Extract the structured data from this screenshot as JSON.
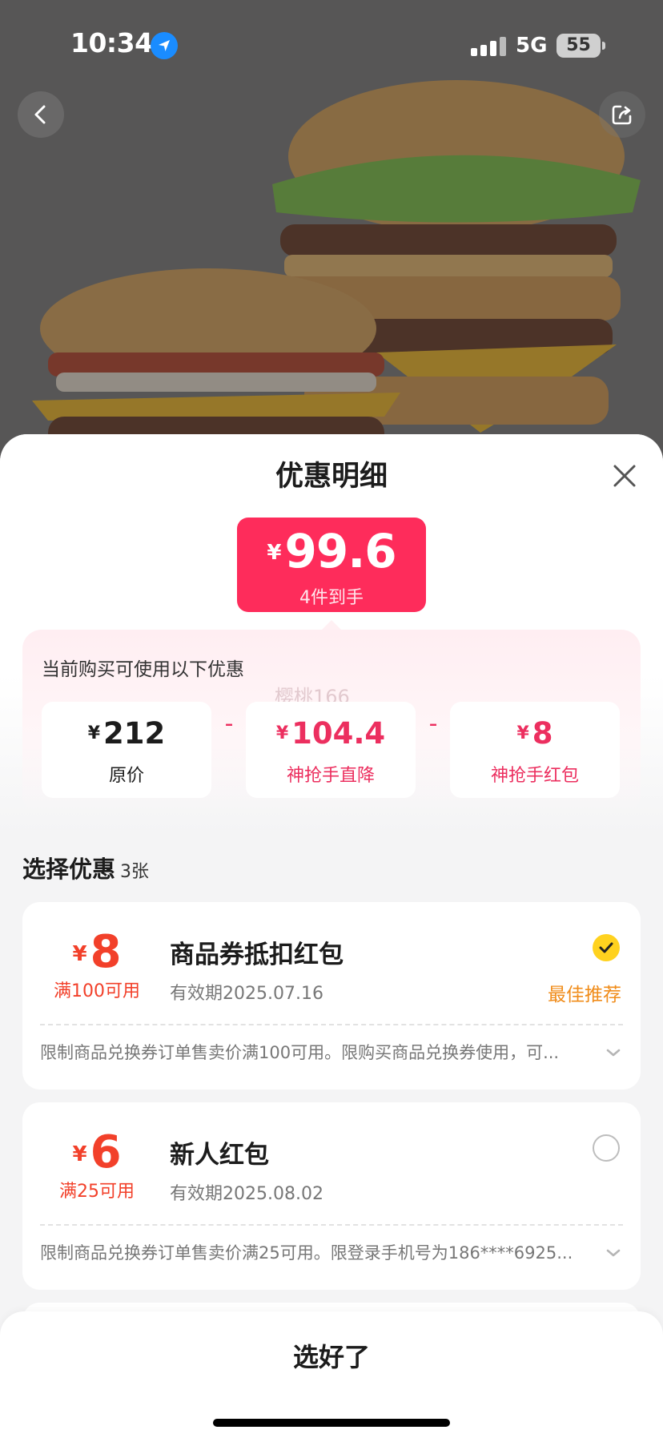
{
  "status_bar": {
    "time": "10:34",
    "network": "5G",
    "battery": "55"
  },
  "sheet": {
    "title": "优惠明细",
    "price": {
      "currency": "¥",
      "amount": "99.6",
      "subtitle": "4件到手"
    },
    "breakdown": {
      "title": "当前购买可使用以下优惠",
      "watermark": "樱桃166",
      "items": [
        {
          "currency": "¥",
          "value": "212",
          "label": "原价"
        },
        {
          "currency": "¥",
          "value": "104.4",
          "label": "神抢手直降"
        },
        {
          "currency": "¥",
          "value": "8",
          "label": "神抢手红包"
        }
      ],
      "operator": "-"
    },
    "select": {
      "title": "选择优惠",
      "count": "3张"
    },
    "coupons": [
      {
        "currency": "¥",
        "amount": "8",
        "condition": "满100可用",
        "name": "商品券抵扣红包",
        "expiry": "有效期2025.07.16",
        "selected": true,
        "badge": "最佳推荐",
        "description": "限制商品兑换券订单售卖价满100可用。限购买商品兑换券使用，可..."
      },
      {
        "currency": "¥",
        "amount": "6",
        "condition": "满25可用",
        "name": "新人红包",
        "expiry": "有效期2025.08.02",
        "selected": false,
        "badge": "",
        "description": "限制商品兑换券订单售卖价满25可用。限登录手机号为186****6925..."
      }
    ],
    "confirm_label": "选好了"
  },
  "colors": {
    "accent": "#fe2c5b",
    "coupon_red": "#f2402a",
    "best_orange": "#f08c1a",
    "check_yellow": "#ffd21f"
  }
}
